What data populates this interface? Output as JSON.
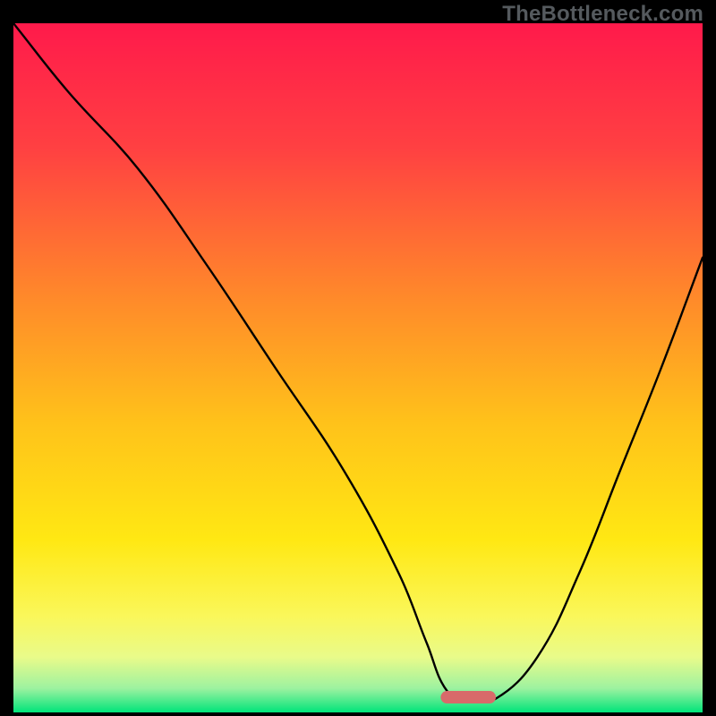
{
  "watermark": "TheBottleneck.com",
  "chart_data": {
    "type": "line",
    "title": "",
    "xlabel": "",
    "ylabel": "",
    "xlim": [
      0,
      100
    ],
    "ylim": [
      0,
      100
    ],
    "gradient_stops": [
      {
        "offset": 0.0,
        "color": "#ff1a4b"
      },
      {
        "offset": 0.18,
        "color": "#ff4042"
      },
      {
        "offset": 0.4,
        "color": "#ff8a2a"
      },
      {
        "offset": 0.58,
        "color": "#ffc21a"
      },
      {
        "offset": 0.75,
        "color": "#ffe813"
      },
      {
        "offset": 0.86,
        "color": "#faf75a"
      },
      {
        "offset": 0.92,
        "color": "#e9fb8a"
      },
      {
        "offset": 0.965,
        "color": "#9df2a0"
      },
      {
        "offset": 1.0,
        "color": "#00e47a"
      }
    ],
    "series": [
      {
        "name": "bottleneck-curve",
        "x": [
          0,
          8,
          18,
          28,
          38,
          48,
          56,
          60,
          63,
          66,
          70,
          76,
          82,
          88,
          94,
          100
        ],
        "y": [
          100,
          90,
          79,
          65,
          50,
          35,
          20,
          10,
          3,
          2,
          2,
          8,
          20,
          35,
          50,
          66
        ]
      }
    ],
    "marker": {
      "name": "optimal-range",
      "x_start": 62,
      "x_end": 70,
      "y": 2.2,
      "color": "#d86a6a"
    }
  }
}
